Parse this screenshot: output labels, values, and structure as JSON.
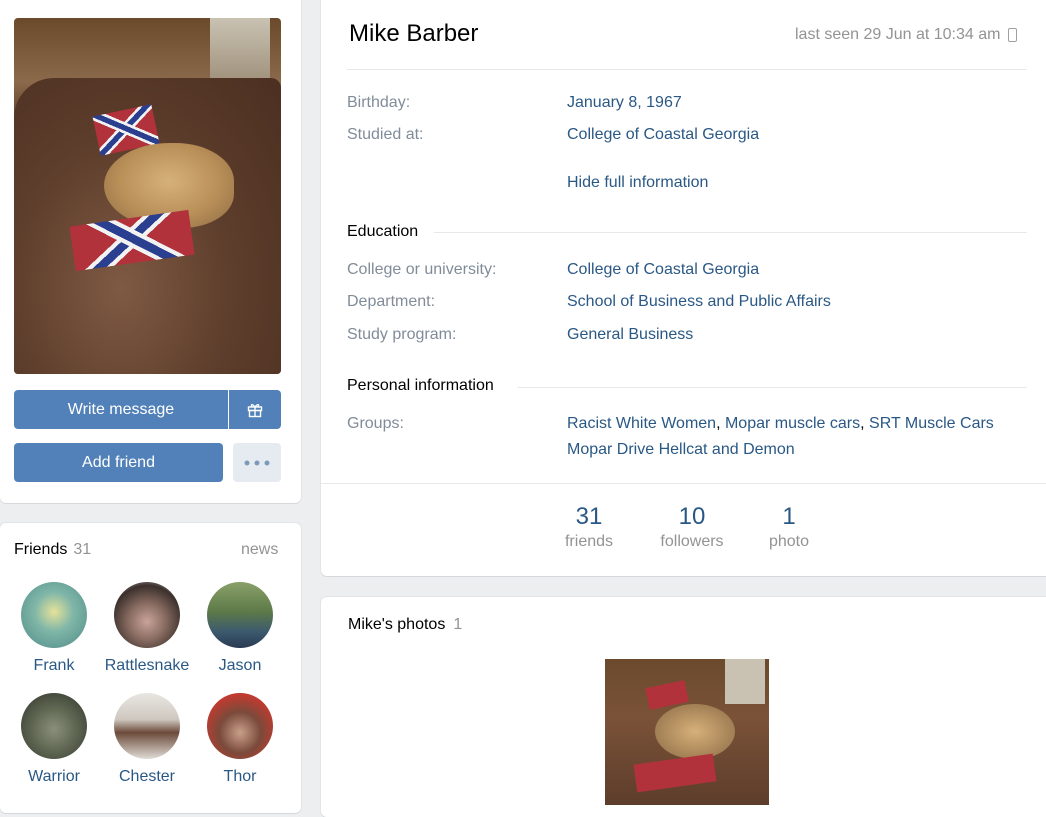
{
  "profile": {
    "name": "Mike Barber",
    "last_seen": "last seen 29 Jun at 10:34 am",
    "buttons": {
      "write_message": "Write message",
      "add_friend": "Add friend"
    }
  },
  "summary": {
    "birthday_label": "Birthday:",
    "birthday_value": "January 8, 1967",
    "studied_label": "Studied at:",
    "studied_value": "College of Coastal Georgia",
    "toggle": "Hide full information"
  },
  "education": {
    "title": "Education",
    "college_label": "College or university:",
    "college_value": "College of Coastal Georgia",
    "department_label": "Department:",
    "department_value": "School of Business and Public Affairs",
    "program_label": "Study program:",
    "program_value": "General Business"
  },
  "personal": {
    "title": "Personal information",
    "groups_label": "Groups:",
    "groups": [
      "Racist White Women",
      "Mopar muscle cars",
      "SRT Muscle Cars",
      "Mopar Drive Hellcat and Demon"
    ]
  },
  "counters": [
    {
      "num": "31",
      "label": "friends"
    },
    {
      "num": "10",
      "label": "followers"
    },
    {
      "num": "1",
      "label": "photo"
    }
  ],
  "friends": {
    "title": "Friends",
    "count": "31",
    "news": "news",
    "list": [
      {
        "name": "Frank",
        "color": "#6fa5a0"
      },
      {
        "name": "Rattlesnake",
        "color": "#7a6a60"
      },
      {
        "name": "Jason",
        "color": "#5f7a4c"
      },
      {
        "name": "Warrior",
        "color": "#6d7560"
      },
      {
        "name": "Chester",
        "color": "#b7a89a"
      },
      {
        "name": "Thor",
        "color": "#8a3a30"
      }
    ]
  },
  "photos": {
    "title": "Mike's photos",
    "count": "1"
  },
  "icons": {
    "gift": "gift-icon",
    "more": "more-dots-icon",
    "phone": "mobile-phone-icon"
  }
}
